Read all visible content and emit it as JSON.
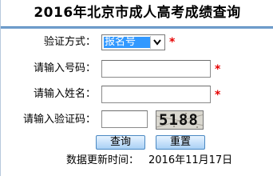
{
  "page": {
    "title": "2016年北京市成人高考成绩查询"
  },
  "form": {
    "verify_method": {
      "label": "验证方式：",
      "selected": "报名号",
      "required_mark": "*"
    },
    "number": {
      "label": "请输入号码：",
      "value": "",
      "required_mark": "*"
    },
    "name": {
      "label": "请输入姓名：",
      "value": "",
      "required_mark": "*"
    },
    "captcha": {
      "label": "请输入验证码：",
      "value": "",
      "image_text": "5188"
    }
  },
  "buttons": {
    "query": "查询",
    "reset": "重置"
  },
  "footer": {
    "update_label": "数据更新时间：",
    "update_date": "2016年11月17日"
  },
  "colors": {
    "header_rule": "#3b78b5",
    "selection": "#3399ff",
    "required": "#e60000",
    "button_border": "#4a88c2"
  }
}
